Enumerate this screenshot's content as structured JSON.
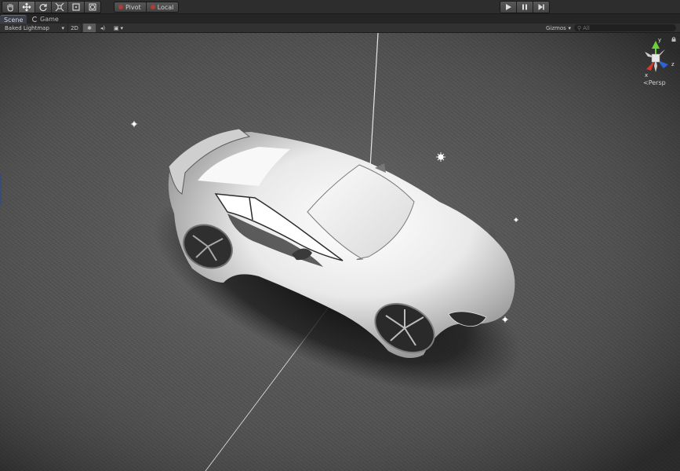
{
  "toolbar": {
    "tools": [
      {
        "name": "hand-tool",
        "icon": "hand-icon"
      },
      {
        "name": "move-tool",
        "icon": "move-icon",
        "active": true
      },
      {
        "name": "rotate-tool",
        "icon": "rotate-icon"
      },
      {
        "name": "scale-tool",
        "icon": "scale-icon"
      },
      {
        "name": "rect-tool",
        "icon": "rect-icon"
      },
      {
        "name": "transform-tool",
        "icon": "transform-icon"
      }
    ],
    "pivot_label": "Pivot",
    "local_label": "Local",
    "play_icons": [
      "play-icon",
      "pause-icon",
      "step-icon"
    ]
  },
  "tabs": {
    "scene_label": "Scene",
    "game_label": "Game"
  },
  "scene_toolbar": {
    "render_mode": "Baked Lightmap",
    "mode_2d": "2D",
    "gizmos_label": "Gizmos",
    "search_placeholder": "All"
  },
  "viewport": {
    "axes": {
      "y": "y",
      "x": "x",
      "z": "z"
    },
    "projection": "Persp",
    "colors": {
      "y_axis": "#6bd13a",
      "x_axis": "#d43a2a",
      "z_axis": "#2f63d8",
      "accent": "#4a6a9c"
    }
  }
}
